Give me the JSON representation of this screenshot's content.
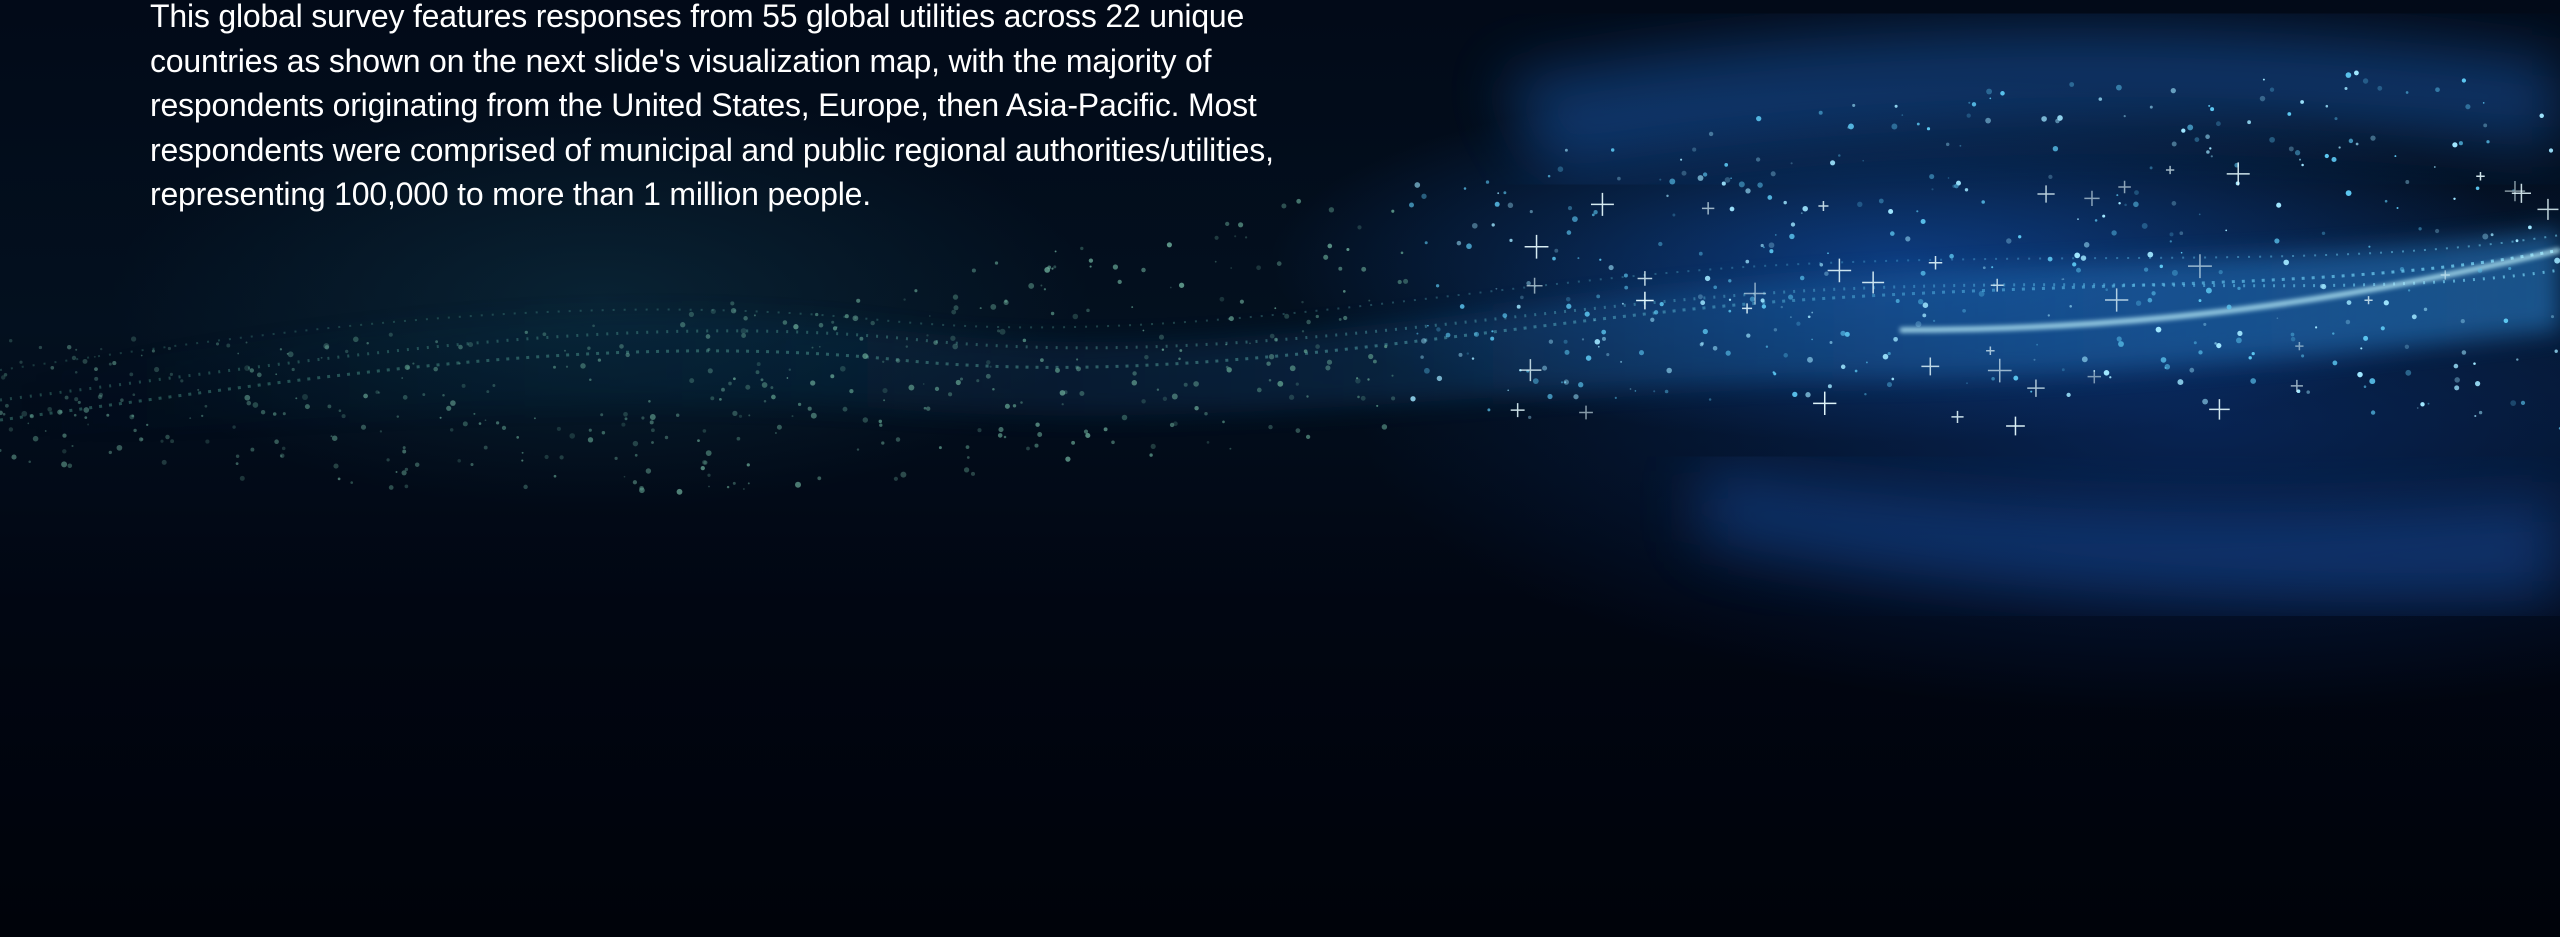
{
  "slide": {
    "body_text": "This global survey features responses from 55 global utilities across 22 unique countries as shown on the next slide's visualization map, with the majority of respondents originating from the United States, Europe, then Asia-Pacific. Most respondents were comprised of municipal and public regional authorities/utilities, representing 100,000 to more than 1 million people."
  },
  "colors": {
    "background": "#01040c",
    "wave_teal": "#5fb3a8",
    "wave_blue": "#2f8fe0",
    "text": "#ffffff"
  }
}
